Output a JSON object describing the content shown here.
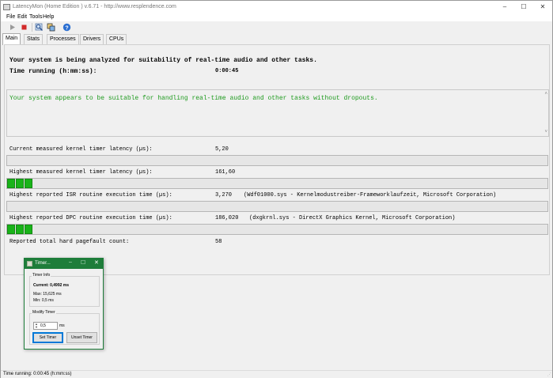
{
  "window": {
    "title": "LatencyMon  (Home Edition )  v.6.71 - http://www.resplendence.com",
    "minimize": "–",
    "maximize": "☐",
    "close": "✕"
  },
  "menu": {
    "file": "File",
    "edit": "Edit",
    "tools": "Tools",
    "help": "Help"
  },
  "toolbar": {
    "start_icon": "play-icon",
    "stop_icon": "stop-icon",
    "analyze_icon": "magnifier-icon",
    "copy_icon": "copy-windows-icon",
    "help_icon": "help-icon"
  },
  "tabs": [
    "Main",
    "Stats",
    "Processes",
    "Drivers",
    "CPUs"
  ],
  "main": {
    "header_line": "Your system is being analyzed for suitability of real-time audio and other tasks.",
    "time_label": "Time running (h:mm:ss):",
    "time_value": "0:00:45",
    "verdict": "Your system appears to be suitable for handling real-time audio and other tasks without dropouts.",
    "verdict_color": "#1f9b1f"
  },
  "metrics": {
    "current": {
      "label": "Current measured kernel timer latency (µs):",
      "value": "5,20",
      "level_segments": 0
    },
    "highest": {
      "label": "Highest measured kernel timer latency (µs):",
      "value": "161,60",
      "level_segments": 3
    },
    "isr": {
      "label": "Highest reported ISR routine execution time (µs):",
      "value": "3,270",
      "detail": "(Wdf01000.sys - Kernelmodustreiber-Frameworklaufzeit, Microsoft Corporation)",
      "level_segments": 0
    },
    "dpc": {
      "label": "Highest reported DPC routine execution time (µs):",
      "value": "186,020",
      "detail": "(dxgkrnl.sys - DirectX Graphics Kernel, Microsoft Corporation)",
      "level_segments": 3
    },
    "pagefault": {
      "label": "Reported total hard pagefault count:",
      "value": "58"
    }
  },
  "colors": {
    "bar_green": "#19b319",
    "dialog_accent": "#1e7d3a"
  },
  "timer_dialog": {
    "title": "Timer...",
    "info_group": "Timer Info",
    "current": "Current: 0,4992 ms",
    "max": "Max: 15,625 ms",
    "min": "Min: 0,5 ms",
    "modify_group": "Modify Timer",
    "input_value": "0,5",
    "unit": "ms",
    "set_button": "Set Timer",
    "unset_button": "Unset Timer"
  },
  "status": {
    "text": "Time running: 0:00:45  (h:mm:ss)"
  }
}
